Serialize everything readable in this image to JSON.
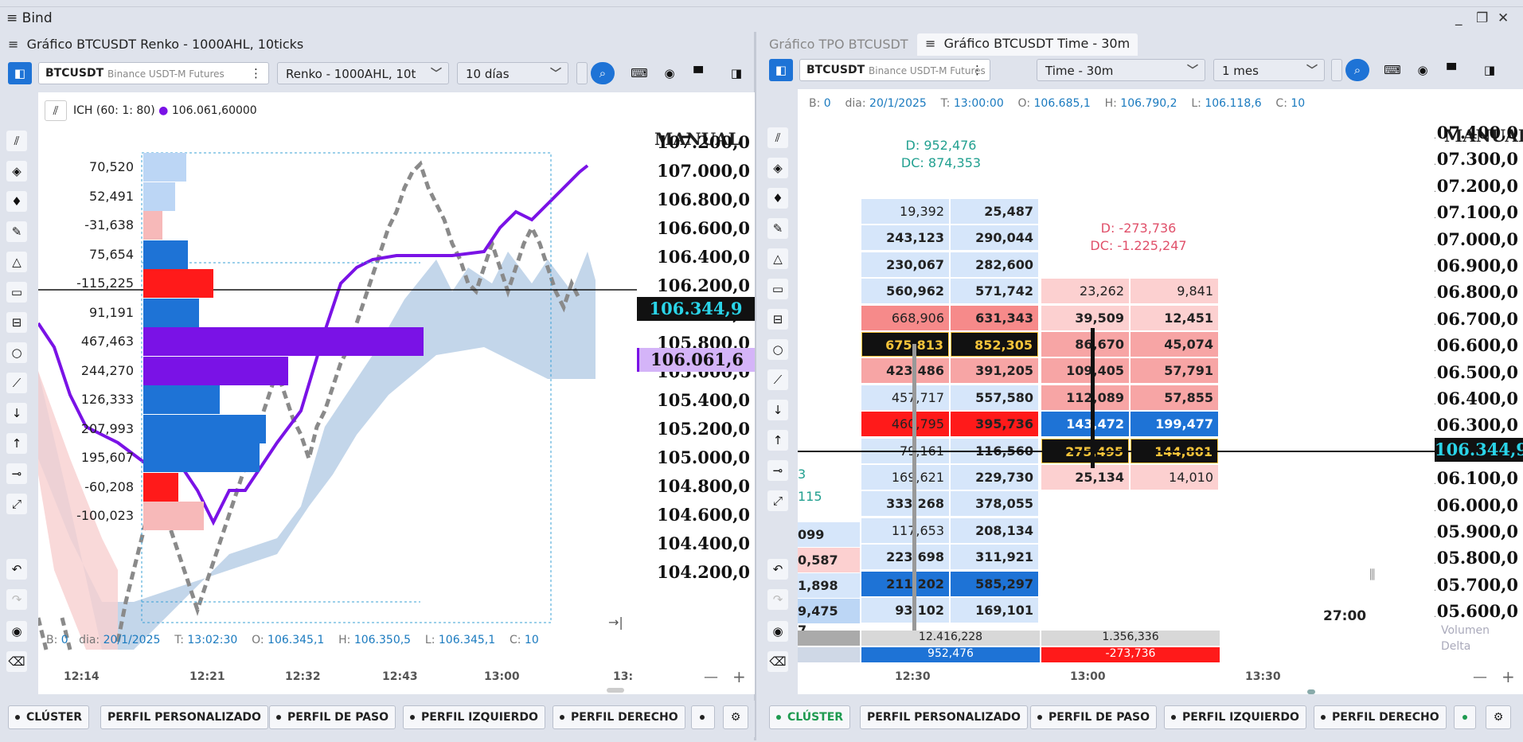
{
  "app": {
    "title": "Bind",
    "menu_icon": "≡"
  },
  "left": {
    "title": "Gráfico BTCUSDT Renko - 1000AHL, 10ticks",
    "symbol": "BTCUSDT",
    "exchange": "Binance USDT-M Futures",
    "chart_type": "Renko - 1000AHL, 10t",
    "period": "10 días",
    "indicator": "ICH (60: 1: 80)",
    "indicator_value": "106.061,60000",
    "mode": "MANUAL",
    "price_labels": [
      "107.200,0",
      "107.000,0",
      "106.800,0",
      "106.600,0",
      "106.400,0",
      "106.200,0",
      "106.000,0",
      "105.800,0",
      "105.600,0",
      "105.400,0",
      "105.200,0",
      "105.000,0",
      "104.800,0",
      "104.600,0",
      "104.400,0",
      "104.200,0"
    ],
    "current_price": "106.344,9",
    "ich_price": "106.061,6",
    "volumes": [
      "70,520",
      "52,491",
      "-31,638",
      "75,654",
      "-115,225",
      "91,191",
      "467,463",
      "244,270",
      "126,333",
      "207,993",
      "195,607",
      "-60,208",
      "-100,023"
    ],
    "times": [
      "12:14",
      "12:21",
      "12:32",
      "12:43",
      "13:00",
      "13:"
    ],
    "status": {
      "B": "0",
      "dia": "20/1/2025",
      "T": "13:02:30",
      "O": "106.345,1",
      "H": "106.350,5",
      "L": "106.345,1",
      "C": "10"
    },
    "minus": "—",
    "plus": "+"
  },
  "right": {
    "tabs": [
      "Gráfico TPO BTCUSDT",
      "Gráfico BTCUSDT Time - 30m"
    ],
    "symbol": "BTCUSDT",
    "exchange": "Binance USDT-M Futures",
    "chart_type": "Time - 30m",
    "period": "1 mes",
    "mode": "MANUAL",
    "status": {
      "B": "0",
      "dia": "20/1/2025",
      "T": "13:00:00",
      "O": "106.685,1",
      "H": "106.790,2",
      "L": "106.118,6",
      "C": "10"
    },
    "price_labels": [
      "107.400,0",
      "107.300,0",
      "107.200,0",
      "107.100,0",
      "107.000,0",
      "106.900,0",
      "106.800,0",
      "106.700,0",
      "106.600,0",
      "106.500,0",
      "106.400,0",
      "106.300,0",
      "106.200,0",
      "106.100,0",
      "106.000,0",
      "105.900,0",
      "105.800,0",
      "105.700,0",
      "105.600,0"
    ],
    "current_price": "106.344,9",
    "d1": "D: 952,476",
    "dc1": "DC: 874,353",
    "d2": "D: -273,736",
    "dc2": "DC: -1.225,247",
    "left_partial": [
      "3",
      "115",
      "099",
      "0,587",
      "1,898",
      "9,475",
      "7"
    ],
    "col1": [
      [
        "19,392",
        "25,487"
      ],
      [
        "243,123",
        "290,044"
      ],
      [
        "230,067",
        "282,600"
      ],
      [
        "560,962",
        "571,742"
      ],
      [
        "668,906",
        "631,343"
      ],
      [
        "675,813",
        "852,305"
      ],
      [
        "423,486",
        "391,205"
      ],
      [
        "457,717",
        "557,580"
      ],
      [
        "460,795",
        "395,736"
      ],
      [
        "79,161",
        "116,560"
      ],
      [
        "169,621",
        "229,730"
      ],
      [
        "333,268",
        "378,055"
      ],
      [
        "117,653",
        "208,134"
      ],
      [
        "223,698",
        "311,921"
      ],
      [
        "211,202",
        "585,297"
      ],
      [
        "93,102",
        "169,101"
      ]
    ],
    "col2": [
      [
        "23,262",
        "9,841"
      ],
      [
        "39,509",
        "12,451"
      ],
      [
        "86,670",
        "45,074"
      ],
      [
        "109,405",
        "57,791"
      ],
      [
        "112,089",
        "57,855"
      ],
      [
        "143,472",
        "199,477"
      ],
      [
        "275,495",
        "144,801"
      ],
      [
        "25,134",
        "14,010"
      ]
    ],
    "totals": {
      "vol1": "12.416,228",
      "vol2": "1.356,336",
      "delta1": "952,476",
      "delta2": "-273,736",
      "vol_label": "Volumen",
      "delta_label": "Delta"
    },
    "countdown": "27:00",
    "times": [
      "12:30",
      "13:00",
      "13:30"
    ],
    "minus": "—",
    "plus": "+"
  },
  "footer": {
    "left": [
      "CLÚSTER",
      "PERFIL PERSONALIZADO",
      "PERFIL DE PASO",
      "PERFIL IZQUIERDO",
      "PERFIL DERECHO"
    ],
    "right": [
      "CLÚSTER",
      "PERFIL PERSONALIZADO",
      "PERFIL DE PASO",
      "PERFIL IZQUIERDO",
      "PERFIL DERECHO"
    ]
  },
  "colors": {
    "accent": "#1e73d6",
    "buy": "#1e73d6",
    "sell": "#ff1a1a",
    "purple": "#7a12e6",
    "cyan": "#2ad4e8"
  }
}
